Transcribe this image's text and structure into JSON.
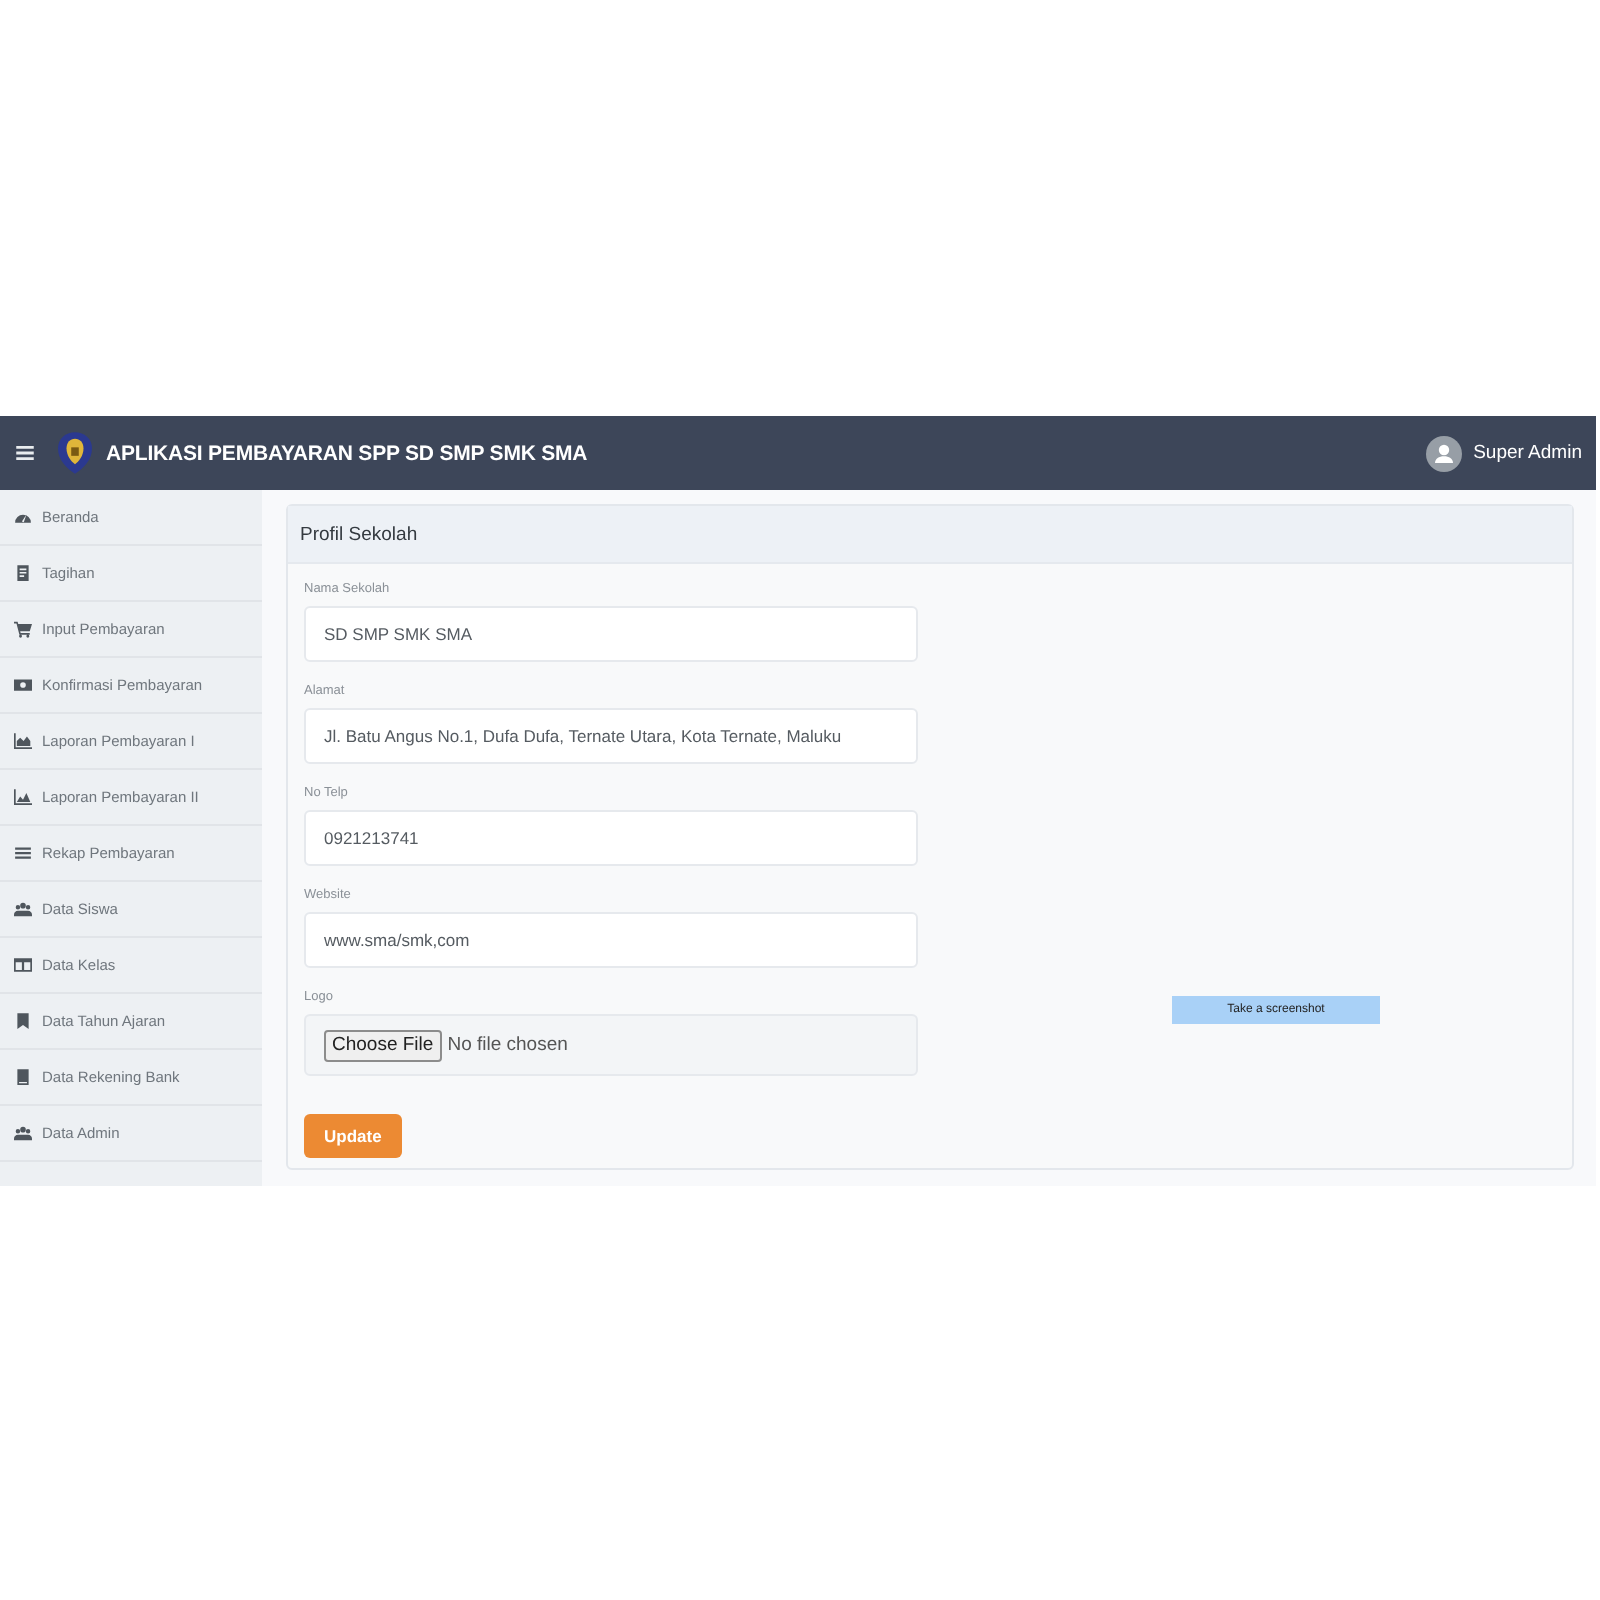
{
  "header": {
    "title": "APLIKASI PEMBAYARAN SPP SD SMP SMK SMA",
    "user": "Super Admin"
  },
  "sidebar": {
    "items": [
      {
        "label": "Beranda"
      },
      {
        "label": "Tagihan"
      },
      {
        "label": "Input Pembayaran"
      },
      {
        "label": "Konfirmasi Pembayaran"
      },
      {
        "label": "Laporan Pembayaran I"
      },
      {
        "label": "Laporan Pembayaran II"
      },
      {
        "label": "Rekap Pembayaran"
      },
      {
        "label": "Data Siswa"
      },
      {
        "label": "Data Kelas"
      },
      {
        "label": "Data Tahun Ajaran"
      },
      {
        "label": "Data Rekening Bank"
      },
      {
        "label": "Data Admin"
      }
    ]
  },
  "card": {
    "title": "Profil Sekolah",
    "fields": [
      {
        "kind": "text",
        "label": "Nama Sekolah",
        "value": "SD SMP SMK SMA"
      },
      {
        "kind": "text",
        "label": "Alamat",
        "value": "Jl. Batu Angus No.1, Dufa Dufa, Ternate Utara, Kota Ternate, Maluku"
      },
      {
        "kind": "text",
        "label": "No Telp",
        "value": "0921213741"
      },
      {
        "kind": "text",
        "label": "Website",
        "value": "www.sma/smk,com"
      },
      {
        "kind": "file",
        "label": "Logo",
        "button": "Choose File",
        "status": "No file chosen"
      }
    ],
    "button": "Update"
  },
  "overlay": {
    "text": "Take a screenshot"
  }
}
